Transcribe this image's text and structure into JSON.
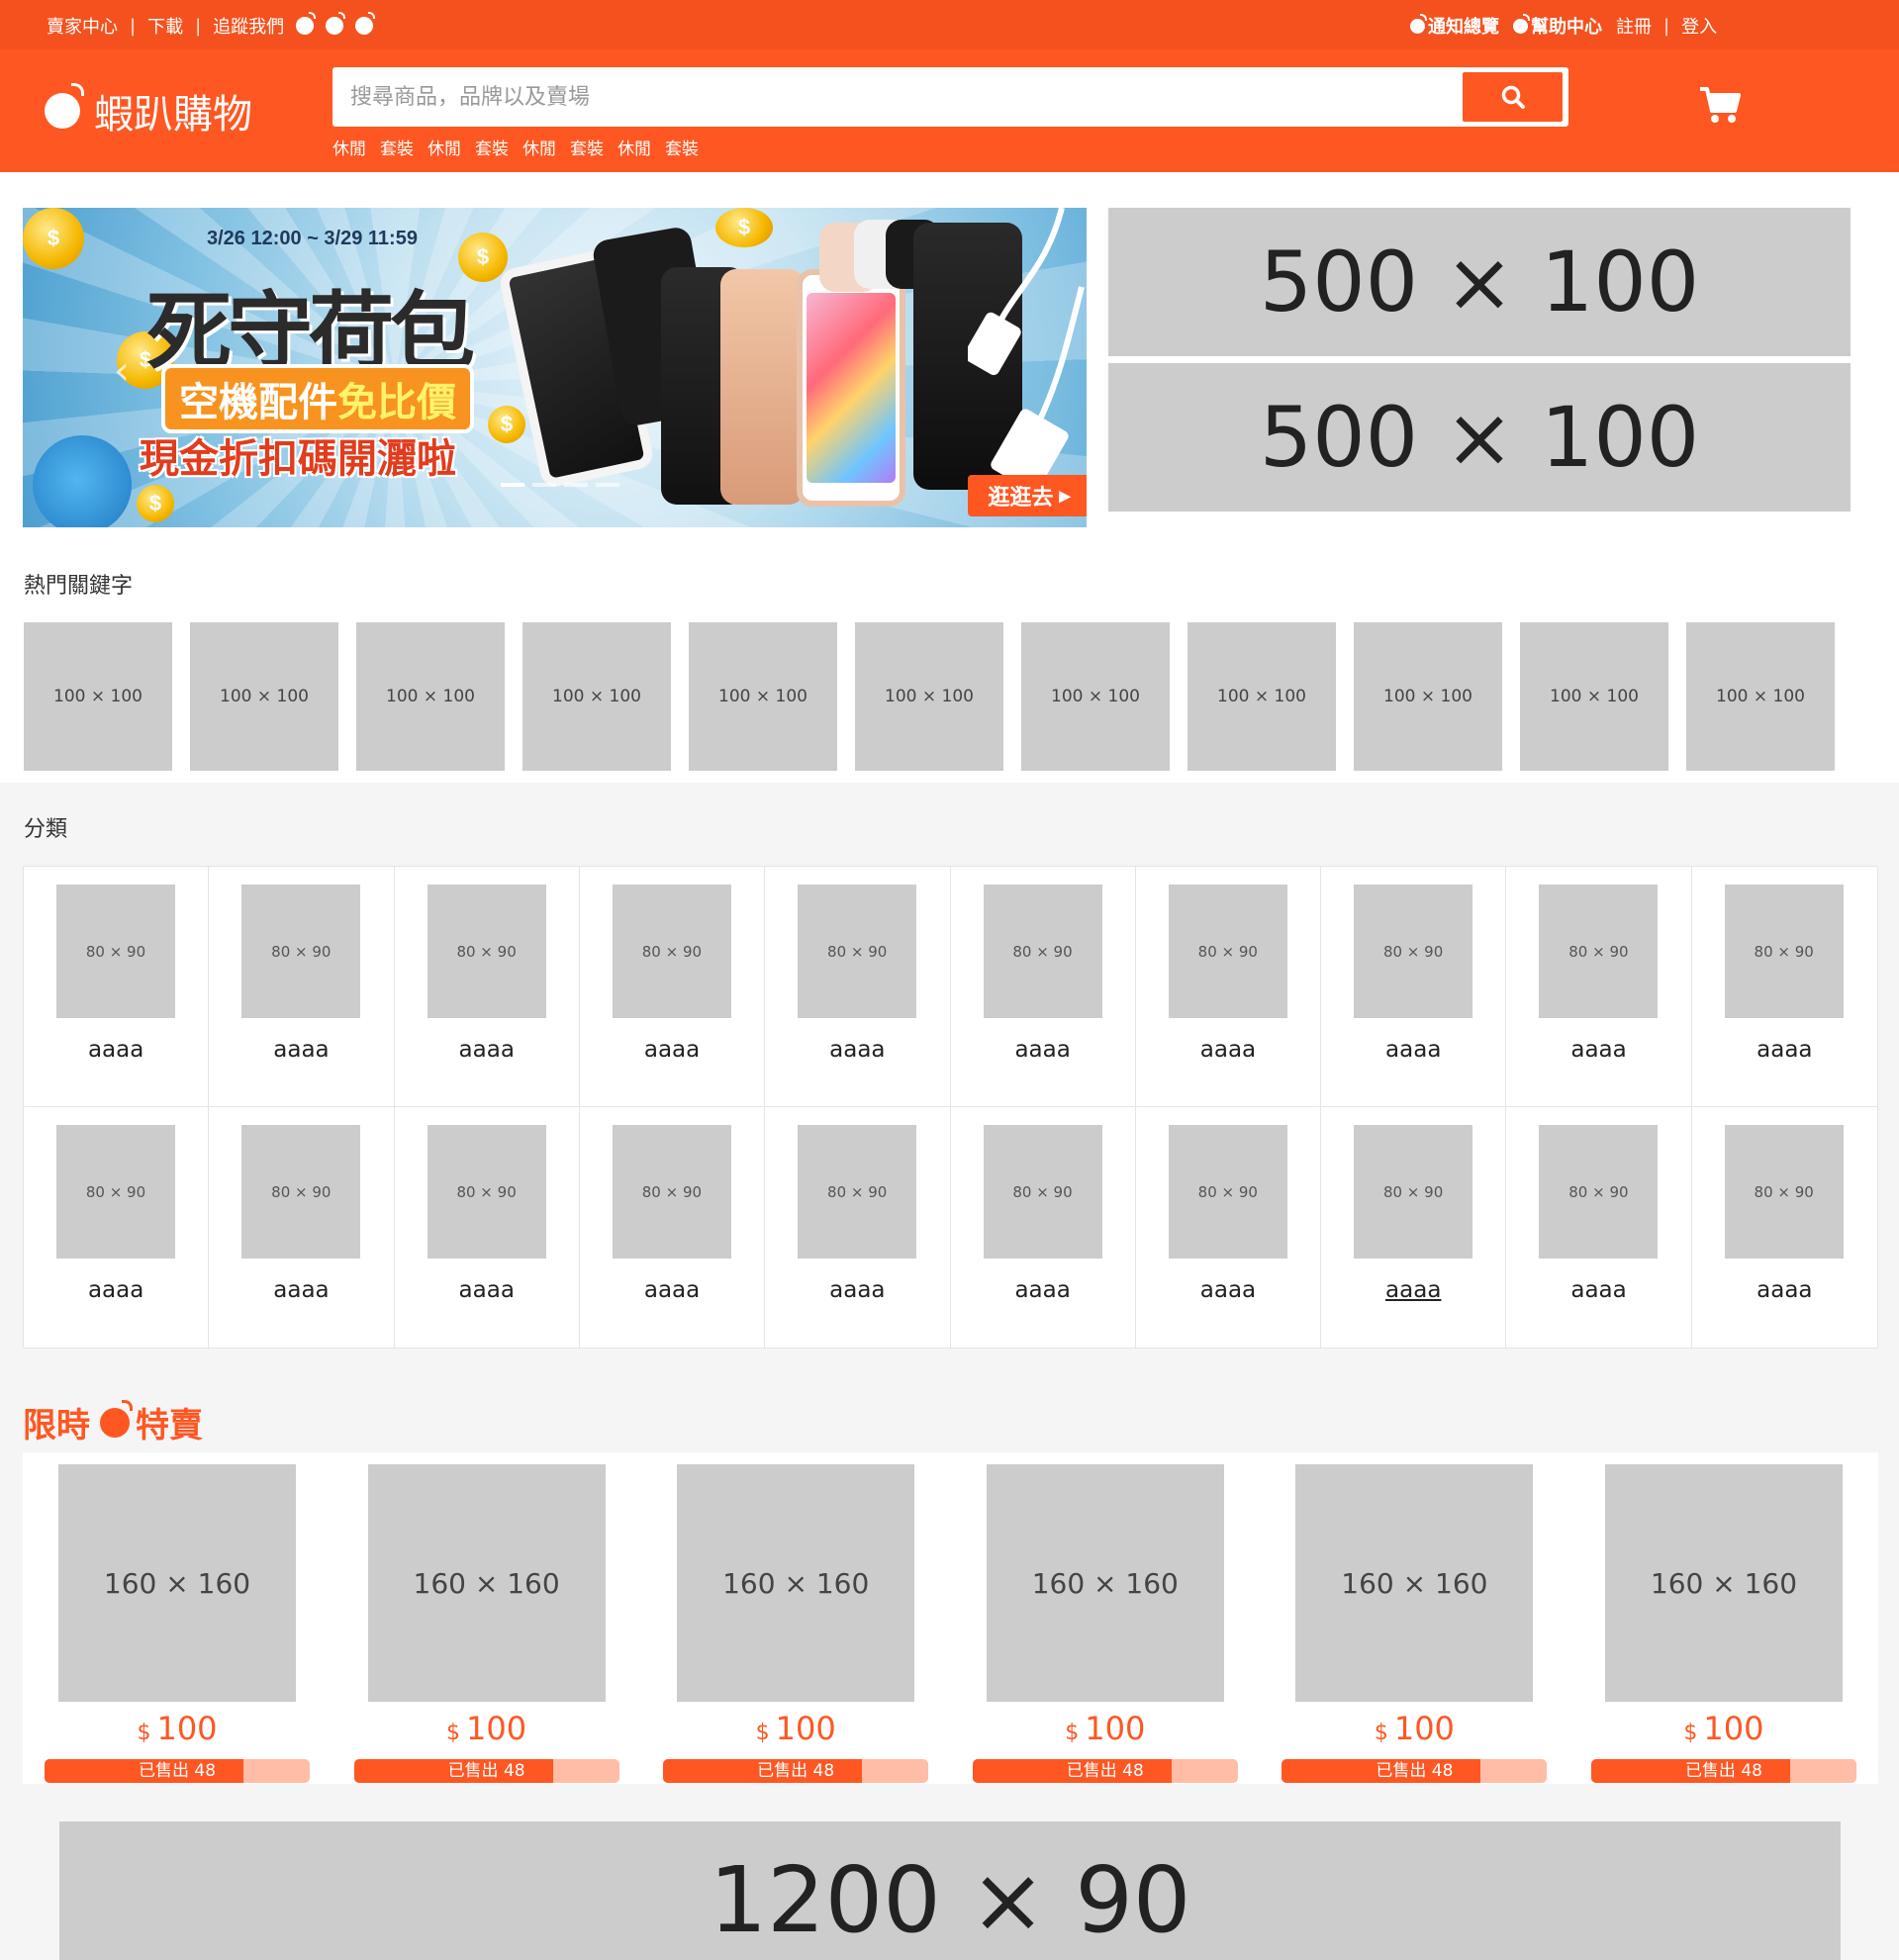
{
  "topbar": {
    "left_links": [
      "賣家中心",
      "下載",
      "追蹤我們"
    ],
    "right_links": [
      {
        "label": "通知總覽",
        "icon": "bomb-icon"
      },
      {
        "label": "幫助中心",
        "icon": "bomb-icon"
      },
      {
        "label": "註冊"
      },
      {
        "label": "登入"
      }
    ]
  },
  "header": {
    "logo_text": "蝦趴購物",
    "search_placeholder": "搜尋商品，品牌以及賣場",
    "search_value": "",
    "hot_words": [
      "休閒",
      "套裝",
      "休閒",
      "套裝",
      "休閒",
      "套裝",
      "休閒",
      "套裝"
    ]
  },
  "banner": {
    "date_range": "3/26 12:00 ~ 3/29 11:59",
    "title": "死守荷包",
    "subtitle_a": "空機配件",
    "subtitle_b": "免比價",
    "subtitle_2": "現金折扣碼開灑啦",
    "cta": "逛逛去",
    "coin_symbol": "$"
  },
  "side_ads": [
    "500 × 100",
    "500 × 100"
  ],
  "hot_keywords": {
    "title": "熱門關鍵字",
    "items": [
      "100 × 100",
      "100 × 100",
      "100 × 100",
      "100 × 100",
      "100 × 100",
      "100 × 100",
      "100 × 100",
      "100 × 100",
      "100 × 100",
      "100 × 100",
      "100 × 100"
    ]
  },
  "categories": {
    "title": "分類",
    "image_label": "80 × 90",
    "items": [
      "aaaa",
      "aaaa",
      "aaaa",
      "aaaa",
      "aaaa",
      "aaaa",
      "aaaa",
      "aaaa",
      "aaaa",
      "aaaa",
      "aaaa",
      "aaaa",
      "aaaa",
      "aaaa",
      "aaaa",
      "aaaa",
      "aaaa",
      "aaaa",
      "aaaa",
      "aaaa"
    ]
  },
  "flash_sale": {
    "title_left": "限時",
    "title_right": "特賣",
    "products": [
      {
        "image": "160 × 160",
        "currency": "$",
        "price": "100",
        "sold": "已售出 48",
        "sold_fraction": 0.75
      },
      {
        "image": "160 × 160",
        "currency": "$",
        "price": "100",
        "sold": "已售出 48",
        "sold_fraction": 0.75
      },
      {
        "image": "160 × 160",
        "currency": "$",
        "price": "100",
        "sold": "已售出 48",
        "sold_fraction": 0.75
      },
      {
        "image": "160 × 160",
        "currency": "$",
        "price": "100",
        "sold": "已售出 48",
        "sold_fraction": 0.75
      },
      {
        "image": "160 × 160",
        "currency": "$",
        "price": "100",
        "sold": "已售出 48",
        "sold_fraction": 0.75
      },
      {
        "image": "160 × 160",
        "currency": "$",
        "price": "100",
        "sold": "已售出 48",
        "sold_fraction": 0.75
      }
    ]
  },
  "bottom_ad": "1200 × 90",
  "colors": {
    "brand": "#fe5722",
    "topbar": "#f4511e",
    "placeholder": "#cccccc"
  }
}
